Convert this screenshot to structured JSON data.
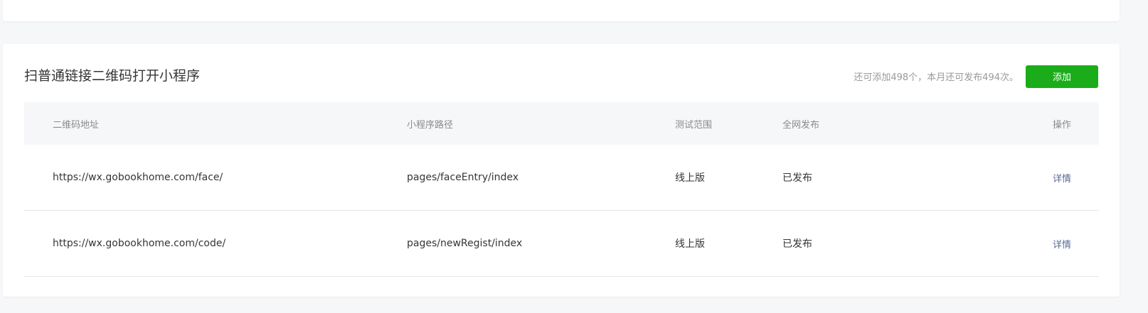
{
  "section": {
    "title": "扫普通链接二维码打开小程序",
    "quota": "还可添加498个，本月还可发布494次。",
    "add_label": "添加"
  },
  "table": {
    "headers": {
      "qr_url": "二维码地址",
      "path": "小程序路径",
      "scope": "测试范围",
      "publish": "全网发布",
      "action": "操作"
    },
    "rows": [
      {
        "qr_url": "https://wx.gobookhome.com/face/",
        "path": "pages/faceEntry/index",
        "scope": "线上版",
        "publish": "已发布",
        "action": "详情"
      },
      {
        "qr_url": "https://wx.gobookhome.com/code/",
        "path": "pages/newRegist/index",
        "scope": "线上版",
        "publish": "已发布",
        "action": "详情"
      }
    ]
  },
  "colors": {
    "accent_green": "#1aad19",
    "link_blue": "#576b95"
  }
}
